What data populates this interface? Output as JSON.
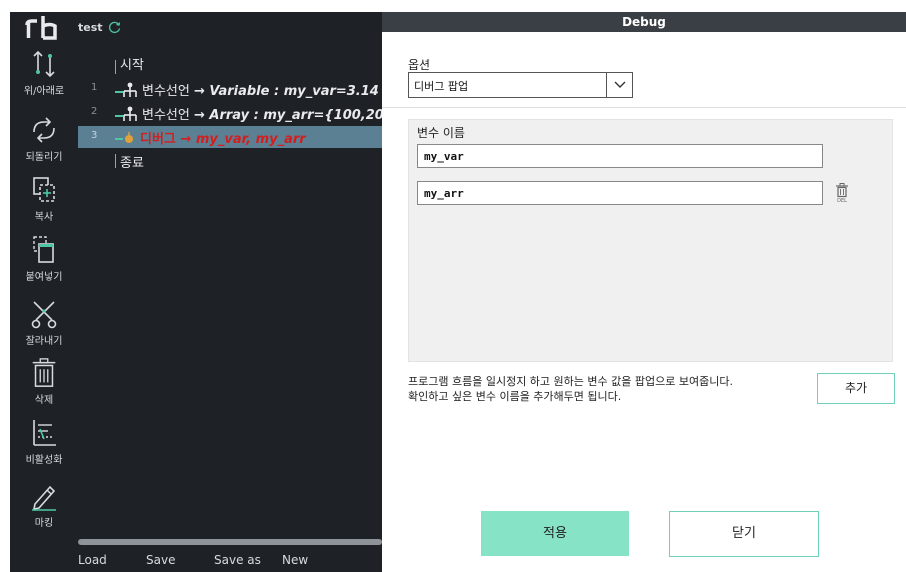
{
  "editor": {
    "logo_icon": "rb-logo",
    "project_name": "test",
    "refresh_icon": "refresh-icon",
    "toolbar": [
      {
        "id": "updown",
        "label": "위/아래로",
        "icon": "up-down-arrows-icon"
      },
      {
        "id": "undo",
        "label": "되돌리기",
        "icon": "undo-redo-icon"
      },
      {
        "id": "copy",
        "label": "복사",
        "icon": "copy-icon"
      },
      {
        "id": "paste",
        "label": "붙여넣기",
        "icon": "paste-icon"
      },
      {
        "id": "cut",
        "label": "잘라내기",
        "icon": "scissors-icon"
      },
      {
        "id": "delete",
        "label": "삭제",
        "icon": "trash-icon"
      },
      {
        "id": "disable",
        "label": "비활성화",
        "icon": "disable-icon"
      },
      {
        "id": "mark",
        "label": "마킹",
        "icon": "pen-icon"
      }
    ],
    "code": {
      "start_label": "시작",
      "end_label": "종료",
      "lines": [
        {
          "num": "1",
          "keyword": "변수선언",
          "detail": "→ Variable : my_var=3.14",
          "icon": "variable-icon"
        },
        {
          "num": "2",
          "keyword": "변수선언",
          "detail": "→ Array : my_arr={100,20",
          "icon": "variable-icon"
        },
        {
          "num": "3",
          "keyword": "디버그",
          "detail": "→ my_var, my_arr",
          "icon": "debug-icon",
          "selected": true
        }
      ]
    },
    "bottom_menu": [
      "Load",
      "Save",
      "Save as",
      "New"
    ]
  },
  "dialog": {
    "title": "Debug",
    "option_label": "옵션",
    "option_value": "디버그 팝업",
    "var_label": "변수 이름",
    "variables": [
      "my_var",
      "my_arr"
    ],
    "delete_label": "DEL",
    "description_1": "프로그램 흐름을 일시정지 하고 원하는 변수 값을 팝업으로 보여줍니다.",
    "description_2": "확인하고 싶은 변수 이름을 추가해두면 됩니다.",
    "add_label": "추가",
    "apply_label": "적용",
    "close_label": "닫기"
  },
  "colors": {
    "editor_bg": "#1e2227",
    "selected_line": "#5b7f93",
    "debug_text": "#d51d1d",
    "accent": "#86e3c6",
    "accent_border": "#6fcfb8",
    "titlebar": "#3a3f45"
  }
}
